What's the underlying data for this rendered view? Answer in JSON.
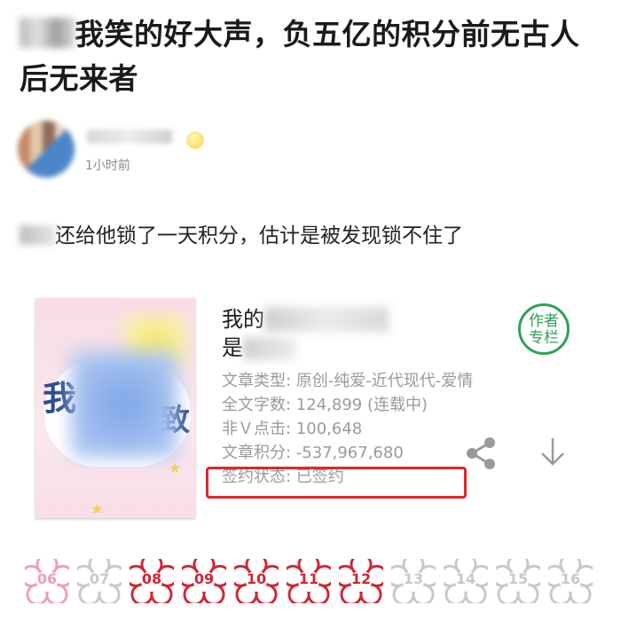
{
  "post": {
    "title_prefix": "",
    "title": "我笑的好大声，负五亿的积分前无古人后无来者",
    "author_time": "1小时前",
    "body": "还给他锁了一天积分，估计是被发现锁不住了"
  },
  "book": {
    "title_visible": "我的",
    "title_line2": "是",
    "type": "文章类型: 原创-纯爱-近代现代-爱情",
    "word_count": "全文字数: 124,899 (连载中)",
    "non_v_clicks": "非Ｖ点击: 100,648",
    "points": "文章积分: -537,967,680",
    "contract": "签约状态:  已签约",
    "column_label_1": "作者",
    "column_label_2": "专栏",
    "icons": [
      "share-icon",
      "download-icon"
    ]
  },
  "flowers": [
    {
      "num": "06",
      "style": "pink"
    },
    {
      "num": "07",
      "style": "grey"
    },
    {
      "num": "08",
      "style": "red"
    },
    {
      "num": "09",
      "style": "red"
    },
    {
      "num": "10",
      "style": "red"
    },
    {
      "num": "11",
      "style": "red"
    },
    {
      "num": "12",
      "style": "red"
    },
    {
      "num": "13",
      "style": "grey"
    },
    {
      "num": "14",
      "style": "grey"
    },
    {
      "num": "15",
      "style": "grey"
    },
    {
      "num": "16",
      "style": "grey"
    }
  ],
  "colors": {
    "highlight": "#e0262b",
    "stamp": "#2ea05a",
    "flower_red": "#cf2536",
    "flower_pink": "#ef9fb2",
    "flower_grey": "#c8c8c8"
  }
}
